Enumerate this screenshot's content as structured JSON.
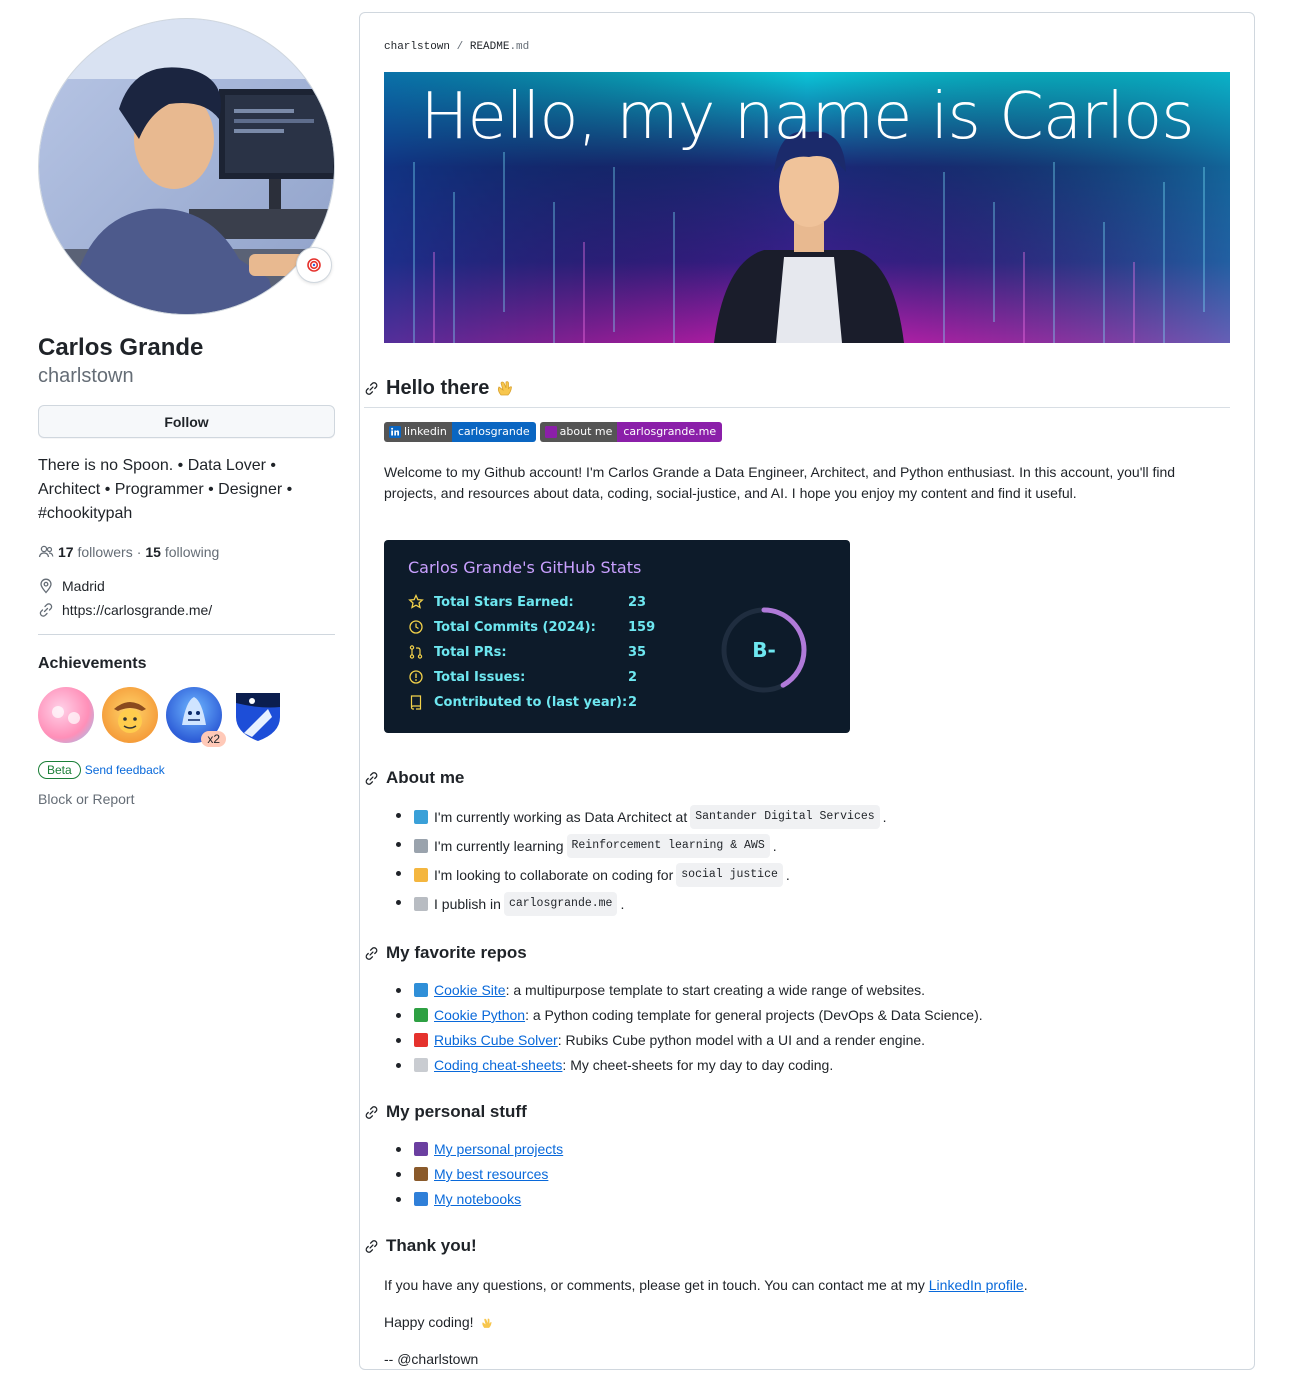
{
  "profile": {
    "name": "Carlos Grande",
    "login": "charlstown",
    "follow_label": "Follow",
    "bio": "There is no Spoon. • Data Lover • Architect • Programmer • Designer • #chookitypah",
    "followers_count": "17",
    "followers_label": "followers",
    "following_count": "15",
    "following_label": "following",
    "separator": "·",
    "location": "Madrid",
    "website": "https://carlosgrande.me/",
    "achievements_title": "Achievements",
    "badge_multiplier": "x2",
    "beta_label": "Beta",
    "send_feedback": "Send feedback",
    "block_report": "Block or Report"
  },
  "readme": {
    "breadcrumb_user": "charlstown",
    "breadcrumb_sep": "/",
    "breadcrumb_file": "README",
    "breadcrumb_ext": ".md",
    "banner_title": "Hello, my name is Carlos",
    "hello_heading": "Hello there",
    "shields": [
      {
        "left": "linkedin",
        "right": "carlosgrande",
        "color": "#0a66c2"
      },
      {
        "left": "about me",
        "right": "carlosgrande.me",
        "color": "#8b1fa9"
      }
    ],
    "welcome": "Welcome to my Github account! I'm Carlos Grande a Data Engineer, Architect, and Python enthusiast. In this account, you'll find projects, and resources about data, coding, social-justice, and AI. I hope you enjoy my content and find it useful.",
    "stats": {
      "title": "Carlos Grande's GitHub Stats",
      "rows": [
        {
          "label": "Total Stars Earned:",
          "value": "23",
          "icon": "star-icon"
        },
        {
          "label": "Total Commits (2024):",
          "value": "159",
          "icon": "history-icon"
        },
        {
          "label": "Total PRs:",
          "value": "35",
          "icon": "pull-request-icon"
        },
        {
          "label": "Total Issues:",
          "value": "2",
          "icon": "issue-icon"
        },
        {
          "label": "Contributed to (last year):",
          "value": "2",
          "icon": "repo-icon"
        }
      ],
      "grade": "B-",
      "grade_progress": 0.42
    },
    "about_heading": "About me",
    "about": [
      {
        "pre": "I'm currently working as Data Architect at",
        "code": "Santander Digital Services",
        "post": ".",
        "emoji": "#3aa0d8"
      },
      {
        "pre": "I'm currently learning",
        "code": "Reinforcement learning & AWS",
        "post": ".",
        "emoji": "#9aa3ad"
      },
      {
        "pre": "I'm looking to collaborate on coding for",
        "code": "social justice",
        "post": ".",
        "emoji": "#f4b63f"
      },
      {
        "pre": "I publish in",
        "code": "carlosgrande.me",
        "post": ".",
        "emoji": "#b8bcc2"
      }
    ],
    "repos_heading": "My favorite repos",
    "repos": [
      {
        "name": "Cookie Site",
        "desc": ": a multipurpose template to start creating a wide range of websites.",
        "emoji": "#2f8fd8"
      },
      {
        "name": "Cookie Python",
        "desc": ": a Python coding template for general projects (DevOps & Data Science).",
        "emoji": "#2ea043"
      },
      {
        "name": "Rubiks Cube Solver",
        "desc": ": Rubiks Cube python model with a UI and a render engine.",
        "emoji": "#e5322d"
      },
      {
        "name": "Coding cheat-sheets",
        "desc": ": My cheet-sheets for my day to day coding.",
        "emoji": "#c9ccd1"
      }
    ],
    "personal_heading": "My personal stuff",
    "personal": [
      {
        "name": "My personal projects",
        "emoji": "#6b3fa0"
      },
      {
        "name": "My best resources",
        "emoji": "#8a5a2b"
      },
      {
        "name": "My notebooks",
        "emoji": "#2f7fd8"
      }
    ],
    "thanks_heading": "Thank you!",
    "thanks_pre": "If you have any questions, or comments, please get in touch. You can contact me at my",
    "thanks_link": "LinkedIn profile",
    "thanks_post": ".",
    "happy": "Happy coding!",
    "signature": "-- @charlstown"
  }
}
